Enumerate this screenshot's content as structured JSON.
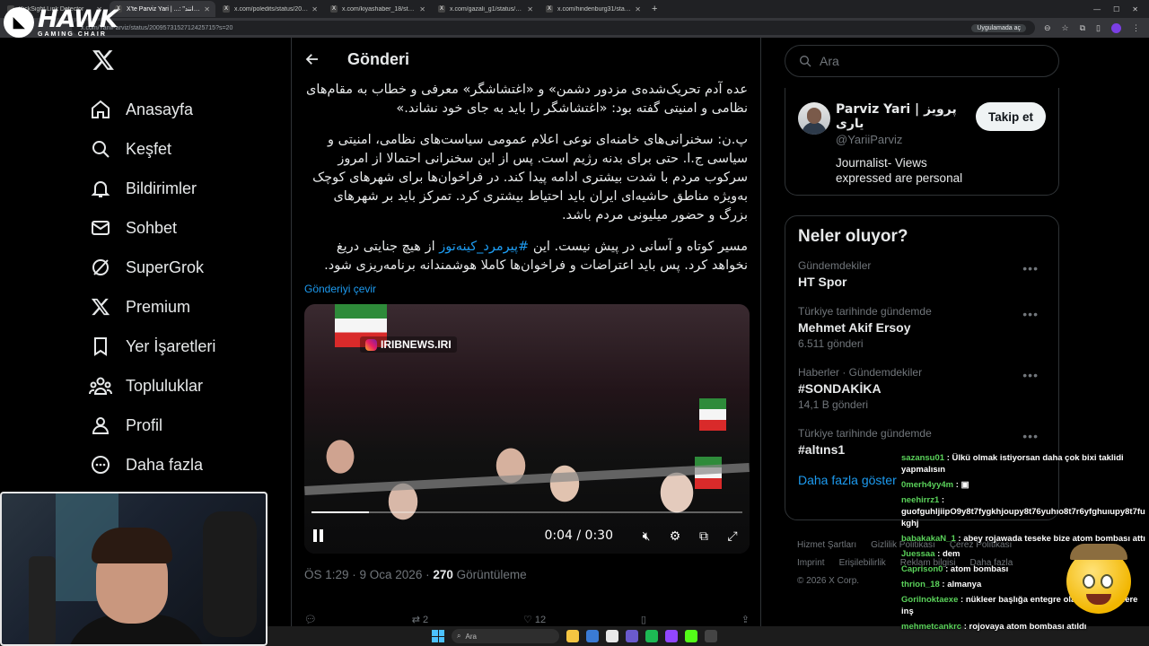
{
  "browser": {
    "tabs": [
      {
        "label": "KickSight Link Detector",
        "active": false
      },
      {
        "label": "X'te Parviz Yari | ...: \"همه به دانند",
        "active": true
      },
      {
        "label": "x.com/poledits/status/2009337",
        "active": false
      },
      {
        "label": "x.com/kiyashaber_18/status/20",
        "active": false
      },
      {
        "label": "x.com/gazali_g1/status/200958",
        "active": false
      },
      {
        "label": "x.com/hindenburg31/status/20",
        "active": false
      }
    ],
    "url": "x.com/YariiParviz/status/2009573152712425715?s=20",
    "app_button": "Uygulamada aç"
  },
  "overlay_logo": {
    "main": "HAWK",
    "sub": "GAMING CHAIR"
  },
  "nav": {
    "items": [
      {
        "label": "Anasayfa",
        "icon": "home-icon"
      },
      {
        "label": "Keşfet",
        "icon": "search-icon"
      },
      {
        "label": "Bildirimler",
        "icon": "bell-icon"
      },
      {
        "label": "Sohbet",
        "icon": "mail-icon"
      },
      {
        "label": "SuperGrok",
        "icon": "grok-icon"
      },
      {
        "label": "Premium",
        "icon": "x-icon"
      },
      {
        "label": "Yer İşaretleri",
        "icon": "bookmark-icon"
      },
      {
        "label": "Topluluklar",
        "icon": "people-icon"
      },
      {
        "label": "Profil",
        "icon": "user-icon"
      },
      {
        "label": "Daha fazla",
        "icon": "more-circle-icon"
      }
    ]
  },
  "main": {
    "title": "Gönderi",
    "tweet": {
      "para1": "عده آدم تحریک‌شده‌ی مزدور دشمن» و «اغتشاشگر» معرفی و خطاب به مقام‌های نظامی و امنیتی گفته بود: «اغتشاشگر را باید به جای خود نشاند.»",
      "para2": "پ.ن: سخنرانی‌های خامنه‌ای نوعی اعلام عمومی سیاست‌های نظامی، امنیتی و سیاسی ج.ا. حتی برای بدنه رژیم است. پس از این سخنرانی احتمالا از امروز سرکوب مردم با شدت بیشتری ادامه پیدا کند. در فراخوان‌ها برای شهرهای کوچک به‌ویژه مناطق حاشیه‌ای ایران باید احتیاط بیشتری کرد. تمرکز باید بر شهرهای بزرگ و حضور میلیونی مردم باشد.",
      "para3_before": "مسیر کوتاه و آسانی در پیش نیست. این ",
      "hashtag": "#پیرمرد_کینه‌توز",
      "para3_after": " از هیچ جنایتی دریغ نخواهد کرد. پس باید  اعتراضات و فراخوان‌ها کاملا هوشمندانه برنامه‌ریزی شود.",
      "translate": "Gönderiyi çevir",
      "watermark": "IRIBNEWS.IRI",
      "video_time": "0:04 / 0:30",
      "progress": 0.133,
      "time": "ÖS 1:29 · 9 Oca 2026 · ",
      "views": "270",
      "views_label": " Görüntüleme",
      "reply_count": "",
      "repost_count": "2",
      "like_count": "12"
    }
  },
  "right": {
    "search_placeholder": "Ara",
    "profile": {
      "name": "Parviz Yari | پرویز یاری",
      "handle": "@YariiParviz",
      "bio": "Journalist- Views expressed are personal",
      "follow": "Takip et"
    },
    "trends_title": "Neler oluyor?",
    "trends": [
      {
        "category": "Gündemdekiler",
        "name": "HT Spor",
        "count": ""
      },
      {
        "category": "Türkiye tarihinde gündemde",
        "name": "Mehmet Akif Ersoy",
        "count": "6.511 gönderi"
      },
      {
        "category": "Haberler · Gündemdekiler",
        "name": "#SONDAKİKA",
        "count": "14,1 B gönderi"
      },
      {
        "category": "Türkiye tarihinde gündemde",
        "name": "#altıns1",
        "count": ""
      }
    ],
    "show_more": "Daha fazla göster",
    "footer": [
      "Hizmet Şartları",
      "Gizlilik Politikası",
      "Çerez Politikası",
      "Imprint",
      "Erişilebilirlik",
      "Reklam bilgisi",
      "Daha fazla",
      "© 2026 X Corp."
    ]
  },
  "chat": [
    {
      "user": "sazansu01",
      "text": "Ülkü olmak istiyorsan daha çok bixi taklidi yapmalısın"
    },
    {
      "user": "0merh4yy4m",
      "text": ""
    },
    {
      "user": "neehirrz1",
      "text": "guofguhljiipO9y8t7fygkhjoupy8t76yuhıo8t7r6yfghuıupy8t7fu kghj"
    },
    {
      "user": "babakakaN_1",
      "text": "abey rojawada teseke bize atom bombası attı"
    },
    {
      "user": "Juessaa",
      "text": "dem"
    },
    {
      "user": "Caprison0",
      "text": "atom bombası"
    },
    {
      "user": "thrion_18",
      "text": "almanya"
    },
    {
      "user": "Gorilnoktaexe",
      "text": "nükleer başlığa entegre olacağınız günlere inş"
    },
    {
      "user": "mehmetcankrc",
      "text": "rojovaya atom bombası atıldı"
    }
  ],
  "taskbar": {
    "search": "Ara"
  },
  "colors": {
    "accent": "#1d9bf0",
    "background": "#000000",
    "chat_user": "#5ad25a"
  }
}
